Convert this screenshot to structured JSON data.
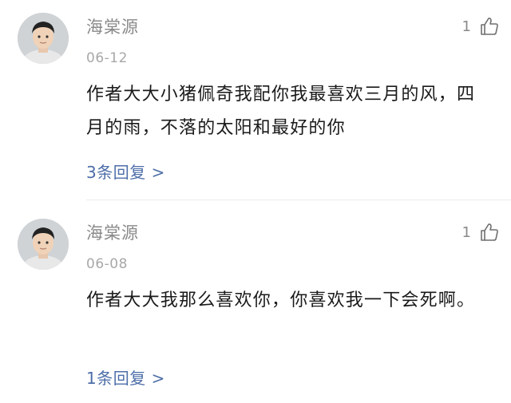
{
  "comments": [
    {
      "username": "海棠源",
      "date": "06-12",
      "content": "作者大大小猪佩奇我配你我最喜欢三月的风，四月的雨，不落的太阳和最好的你",
      "likes": "1",
      "replies": "3条回复 >"
    },
    {
      "username": "海棠源",
      "date": "06-08",
      "content": "作者大大我那么喜欢你，你喜欢我一下会死啊。",
      "likes": "1",
      "replies": "1条回复 >"
    }
  ],
  "icons": {
    "like": "thumbs-up-icon",
    "avatar": "user-avatar"
  },
  "colors": {
    "reply_link": "#4d6ea8",
    "meta_text": "#8a8a8a",
    "body_text": "#1a1a1a"
  }
}
